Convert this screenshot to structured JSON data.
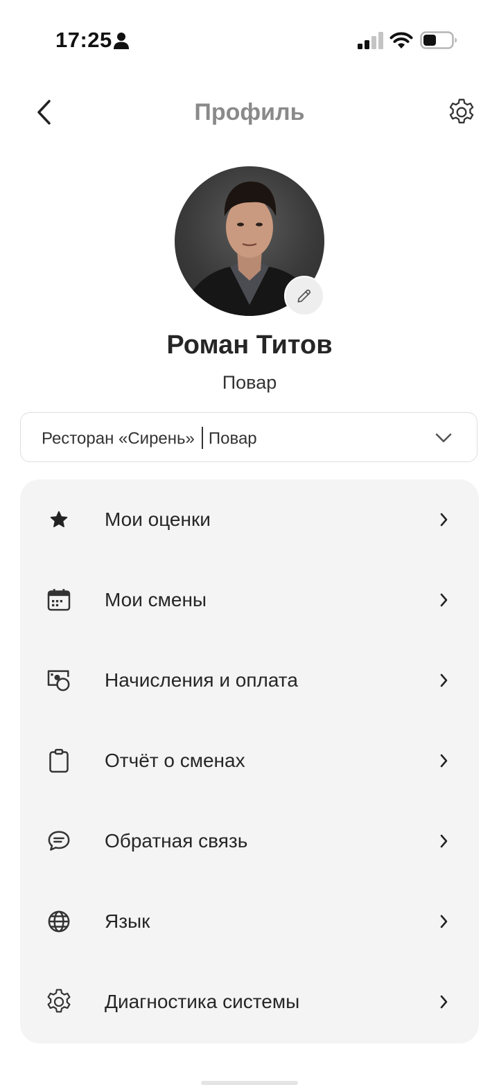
{
  "status_bar": {
    "time": "17:25"
  },
  "header": {
    "title": "Профиль",
    "back_icon": "chevron-left-icon",
    "settings_icon": "gear-icon"
  },
  "profile": {
    "name": "Роман Титов",
    "role": "Повар",
    "edit_icon": "pencil-icon"
  },
  "workplace": {
    "restaurant": "Ресторан «Сирень»",
    "position": "Повар"
  },
  "menu": {
    "items": [
      {
        "label": "Мои оценки",
        "icon": "star-icon"
      },
      {
        "label": "Мои смены",
        "icon": "calendar-icon"
      },
      {
        "label": "Начисления и оплата",
        "icon": "payment-icon"
      },
      {
        "label": "Отчёт о сменах",
        "icon": "clipboard-icon"
      },
      {
        "label": "Обратная связь",
        "icon": "chat-bubble-icon"
      },
      {
        "label": "Язык",
        "icon": "globe-icon"
      },
      {
        "label": "Диагностика системы",
        "icon": "gear-icon"
      }
    ]
  },
  "colors": {
    "title_gray": "#8a8a8a",
    "text_dark": "#262626",
    "menu_background": "#f4f4f4",
    "border": "#dedede"
  }
}
